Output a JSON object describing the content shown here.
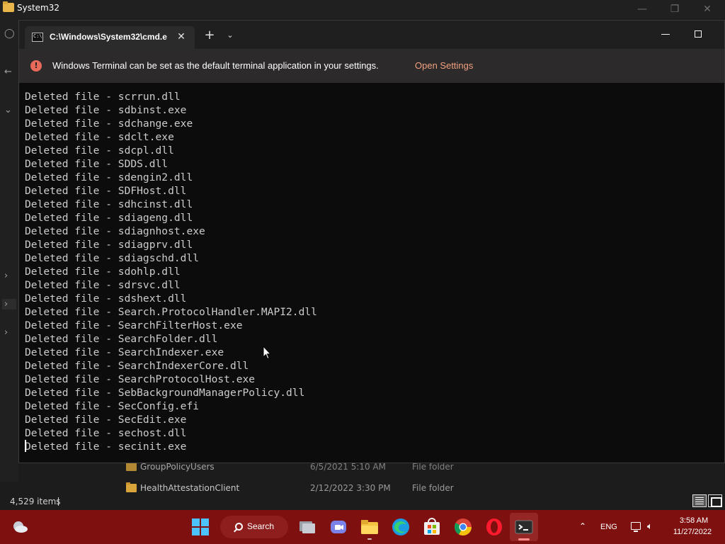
{
  "explorer": {
    "title": "System32",
    "status": {
      "item_count": "4,529 items"
    },
    "rows": [
      {
        "name": "GroupPolicyUsers",
        "date": "6/5/2021 5:10 AM",
        "type": "File folder"
      },
      {
        "name": "HealthAttestationClient",
        "date": "2/12/2022 3:30 PM",
        "type": "File folder"
      }
    ]
  },
  "terminal": {
    "tab_title": "C:\\Windows\\System32\\cmd.e",
    "infobar": {
      "message": "Windows Terminal can be set as the default terminal application in your settings.",
      "link": "Open Settings"
    },
    "lines": [
      "Deleted file - scrrun.dll",
      "Deleted file - sdbinst.exe",
      "Deleted file - sdchange.exe",
      "Deleted file - sdclt.exe",
      "Deleted file - sdcpl.dll",
      "Deleted file - SDDS.dll",
      "Deleted file - sdengin2.dll",
      "Deleted file - SDFHost.dll",
      "Deleted file - sdhcinst.dll",
      "Deleted file - sdiageng.dll",
      "Deleted file - sdiagnhost.exe",
      "Deleted file - sdiagprv.dll",
      "Deleted file - sdiagschd.dll",
      "Deleted file - sdohlp.dll",
      "Deleted file - sdrsvc.dll",
      "Deleted file - sdshext.dll",
      "Deleted file - Search.ProtocolHandler.MAPI2.dll",
      "Deleted file - SearchFilterHost.exe",
      "Deleted file - SearchFolder.dll",
      "Deleted file - SearchIndexer.exe",
      "Deleted file - SearchIndexerCore.dll",
      "Deleted file - SearchProtocolHost.exe",
      "Deleted file - SebBackgroundManagerPolicy.dll",
      "Deleted file - SecConfig.efi",
      "Deleted file - SecEdit.exe",
      "Deleted file - sechost.dll",
      "Deleted file - secinit.exe"
    ]
  },
  "taskbar": {
    "search_label": "Search",
    "lang": "ENG",
    "time": "3:58 AM",
    "date": "11/27/2022",
    "apps": [
      "task-view",
      "teams-chat",
      "file-explorer",
      "edge",
      "microsoft-store",
      "chrome",
      "opera",
      "terminal"
    ]
  },
  "colors": {
    "taskbar": "#7e1010",
    "console_bg": "#0c0c0c",
    "console_text": "#cccccc",
    "link": "#f0a080",
    "accent": "#4cc2ff"
  }
}
